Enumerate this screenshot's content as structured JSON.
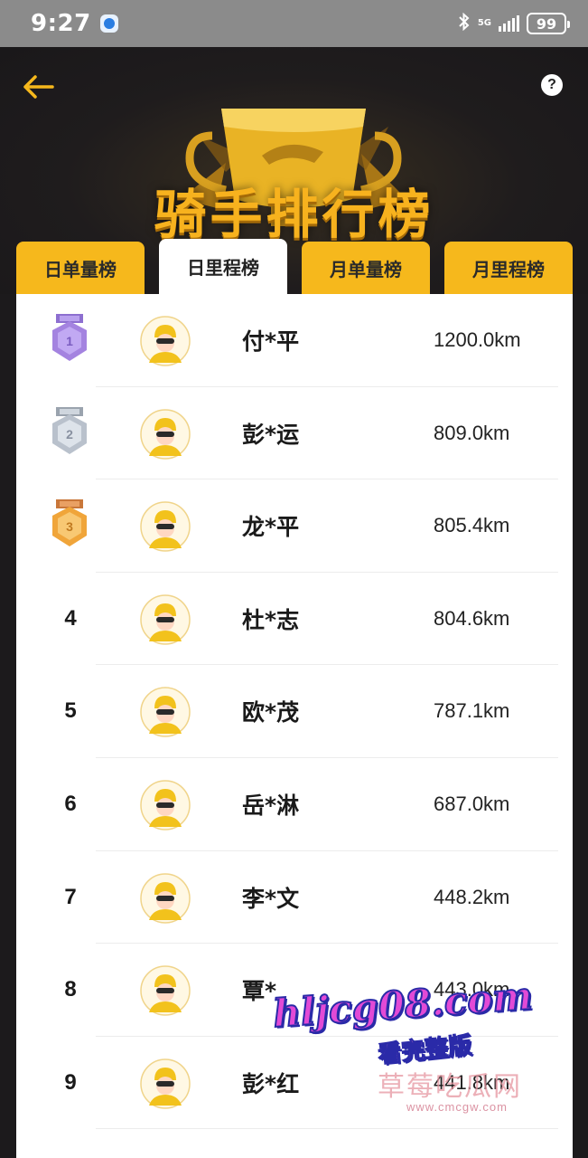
{
  "status_bar": {
    "time": "9:27",
    "network": "5G",
    "battery": "99"
  },
  "header": {
    "title": "骑手排行榜",
    "help_label": "?"
  },
  "tabs": [
    {
      "label": "日单量榜",
      "active": false
    },
    {
      "label": "日里程榜",
      "active": true
    },
    {
      "label": "月单量榜",
      "active": false
    },
    {
      "label": "月里程榜",
      "active": false
    }
  ],
  "ranking": [
    {
      "rank": "1",
      "medal": "purple",
      "name": "付*平",
      "distance": "1200.0km"
    },
    {
      "rank": "2",
      "medal": "silver",
      "name": "彭*运",
      "distance": "809.0km"
    },
    {
      "rank": "3",
      "medal": "bronze",
      "name": "龙*平",
      "distance": "805.4km"
    },
    {
      "rank": "4",
      "name": "杜*志",
      "distance": "804.6km"
    },
    {
      "rank": "5",
      "name": "欧*茂",
      "distance": "787.1km"
    },
    {
      "rank": "6",
      "name": "岳*淋",
      "distance": "687.0km"
    },
    {
      "rank": "7",
      "name": "李*文",
      "distance": "448.2km"
    },
    {
      "rank": "8",
      "name": "覃*",
      "distance": "443.0km"
    },
    {
      "rank": "9",
      "name": "彭*红",
      "distance": "441.8km"
    }
  ],
  "watermark": {
    "url": "hljcg08.com",
    "tagline": "看完整版",
    "site_name": "草莓吃瓜网",
    "domain": "www.cmcgw.com"
  },
  "colors": {
    "accent": "#f6b81c",
    "background": "#1c1a1c",
    "medal_gold": "#f0a53a",
    "medal_silver": "#b9c1cc",
    "medal_purple": "#a483e0"
  }
}
